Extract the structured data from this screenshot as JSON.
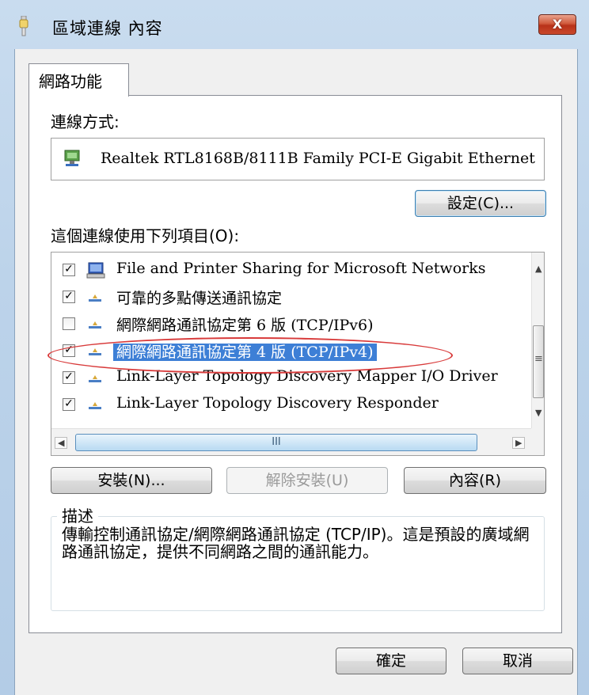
{
  "window": {
    "title": "區域連線 內容",
    "close_label": "X"
  },
  "tabs": [
    {
      "label": "網路功能"
    }
  ],
  "connection": {
    "label": "連線方式:",
    "adapter": "Realtek RTL8168B/8111B Family PCI-E Gigabit Ethernet",
    "configure_button": "設定(C)..."
  },
  "items_section": {
    "label": "這個連線使用下列項目(O):",
    "items": [
      {
        "label": "File and Printer Sharing for Microsoft Networks",
        "checked": true,
        "icon": "network-client-icon"
      },
      {
        "label": "可靠的多點傳送通訊協定",
        "checked": true,
        "icon": "protocol-icon"
      },
      {
        "label": "網際網路通訊協定第 6 版 (TCP/IPv6)",
        "checked": false,
        "icon": "protocol-icon"
      },
      {
        "label": "網際網路通訊協定第 4 版 (TCP/IPv4)",
        "checked": true,
        "icon": "protocol-icon",
        "selected": true
      },
      {
        "label": "Link-Layer Topology Discovery Mapper I/O Driver",
        "checked": true,
        "icon": "protocol-icon"
      },
      {
        "label": "Link-Layer Topology Discovery Responder",
        "checked": true,
        "icon": "protocol-icon"
      }
    ],
    "hscroll_grip": "III",
    "vscroll_grip": "≡"
  },
  "buttons": {
    "install": "安裝(N)...",
    "uninstall": "解除安裝(U)",
    "properties": "內容(R)",
    "ok": "確定",
    "cancel": "取消"
  },
  "description": {
    "title": "描述",
    "text": "傳輸控制通訊協定/網際網路通訊協定 (TCP/IP)。這是預設的廣域網路通訊協定，提供不同網路之間的通訊能力。"
  },
  "colors": {
    "selection": "#3d7fd6",
    "highlight_ellipse": "#d83a3a",
    "titlebar": "#bcd3ea"
  }
}
